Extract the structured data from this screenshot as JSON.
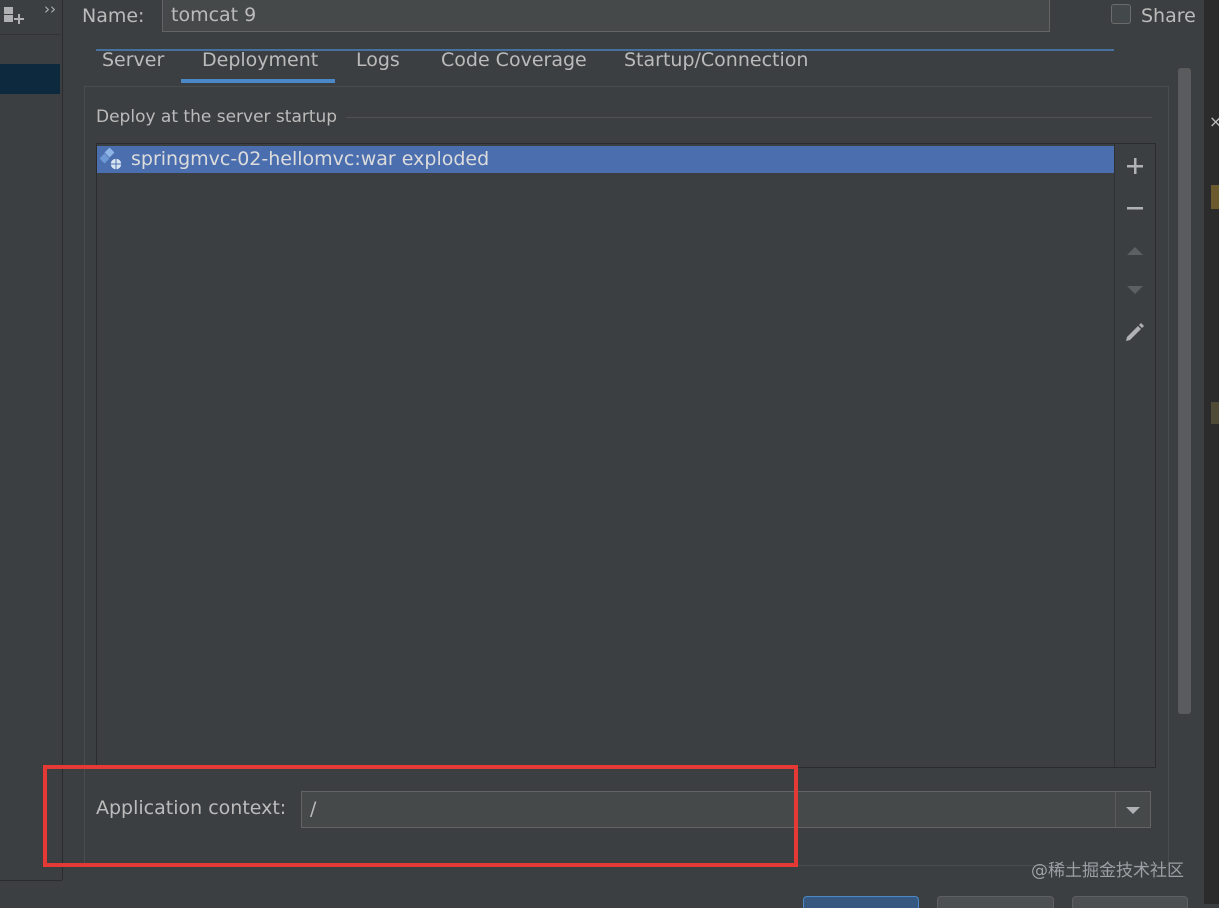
{
  "header": {
    "name_label": "Name:",
    "name_value": "tomcat 9",
    "share_label": "Share",
    "share_checked": false
  },
  "tabs": [
    {
      "label": "Server",
      "active": false
    },
    {
      "label": "Deployment",
      "active": true
    },
    {
      "label": "Logs",
      "active": false
    },
    {
      "label": "Code Coverage",
      "active": false
    },
    {
      "label": "Startup/Connection",
      "active": false
    }
  ],
  "deployment": {
    "section_title": "Deploy at the server startup",
    "artifacts": [
      {
        "label": "springmvc-02-hellomvc:war exploded",
        "icon": "artifact-icon",
        "selected": true
      }
    ],
    "side_buttons": [
      {
        "icon": "plus-icon"
      },
      {
        "icon": "minus-icon"
      },
      {
        "icon": "move-up-icon"
      },
      {
        "icon": "move-down-icon"
      },
      {
        "icon": "edit-icon"
      }
    ]
  },
  "context": {
    "label": "Application context:",
    "value": "/"
  },
  "watermark": "@稀土掘金技术社区",
  "colors": {
    "background": "#3c3f41",
    "selection": "#4b6eaf",
    "accent": "#4a88c7",
    "highlight": "#e53935"
  }
}
